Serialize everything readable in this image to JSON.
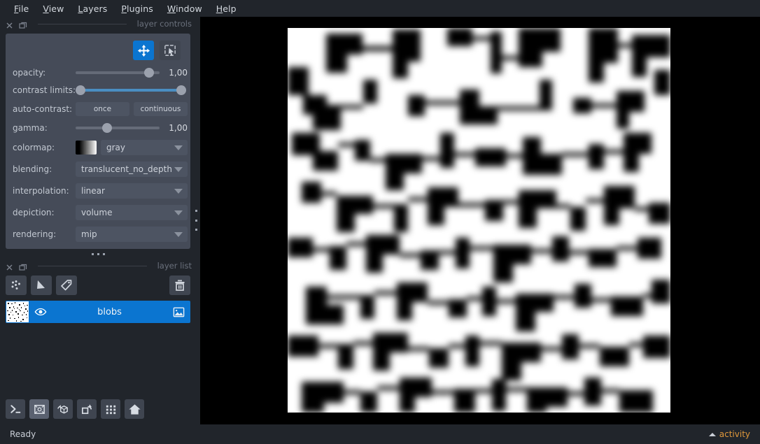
{
  "app": {
    "title": "napari",
    "bg_color": "#21252b",
    "panel_color": "#454b58",
    "accent_color": "#0b75d0",
    "activity_color": "#e0983b"
  },
  "menubar": {
    "items": [
      {
        "label": "File",
        "mnemonic": "F"
      },
      {
        "label": "View",
        "mnemonic": "V"
      },
      {
        "label": "Layers",
        "mnemonic": "L"
      },
      {
        "label": "Plugins",
        "mnemonic": "P"
      },
      {
        "label": "Window",
        "mnemonic": "W"
      },
      {
        "label": "Help",
        "mnemonic": "H"
      }
    ]
  },
  "layer_controls": {
    "dock_title": "layer controls",
    "mode_buttons": [
      {
        "name": "pan-zoom",
        "icon": "move-icon",
        "active": true
      },
      {
        "name": "transform",
        "icon": "transform-icon",
        "active": false
      }
    ],
    "rows": {
      "opacity": {
        "label": "opacity:",
        "value": "1,00",
        "handle_pct": 92
      },
      "contrast_limits": {
        "label": "contrast limits:",
        "low_pct": 0,
        "high_pct": 100
      },
      "auto_contrast": {
        "label": "auto-contrast:",
        "once": "once",
        "continuous": "continuous"
      },
      "gamma": {
        "label": "gamma:",
        "value": "1,00",
        "handle_pct": 36
      },
      "colormap": {
        "label": "colormap:",
        "value": "gray"
      },
      "blending": {
        "label": "blending:",
        "value": "translucent_no_depth"
      },
      "interpolation": {
        "label": "interpolation:",
        "value": "linear"
      },
      "depiction": {
        "label": "depiction:",
        "value": "volume"
      },
      "rendering": {
        "label": "rendering:",
        "value": "mip"
      }
    }
  },
  "layer_list": {
    "dock_title": "layer list",
    "buttons": [
      {
        "name": "new-points-layer",
        "icon": "points-icon"
      },
      {
        "name": "new-shapes-layer",
        "icon": "shapes-icon"
      },
      {
        "name": "new-labels-layer",
        "icon": "labels-icon"
      },
      {
        "name": "delete-layer",
        "icon": "trash-icon"
      }
    ],
    "layers": [
      {
        "name": "blobs",
        "visible": true,
        "selected": true,
        "type_icon": "image-icon",
        "visibility_icon": "eye-icon"
      }
    ]
  },
  "viewer_buttons": [
    {
      "name": "console",
      "icon": "console-icon",
      "active": false
    },
    {
      "name": "ndisplay-toggle",
      "icon": "cube-3d-icon",
      "active": true
    },
    {
      "name": "roll-dimensions",
      "icon": "roll-dims-icon",
      "active": false
    },
    {
      "name": "transpose-dimensions",
      "icon": "transpose-dims-icon",
      "active": false
    },
    {
      "name": "grid-view",
      "icon": "grid-icon",
      "active": false
    },
    {
      "name": "reset-view",
      "icon": "home-icon",
      "active": false
    }
  ],
  "canvas": {
    "layer_rendered": "blobs",
    "background": "#000000",
    "image_description": "binary blobs, white background with black blob structures"
  },
  "status_bar": {
    "status": "Ready",
    "activity_label": "activity"
  }
}
